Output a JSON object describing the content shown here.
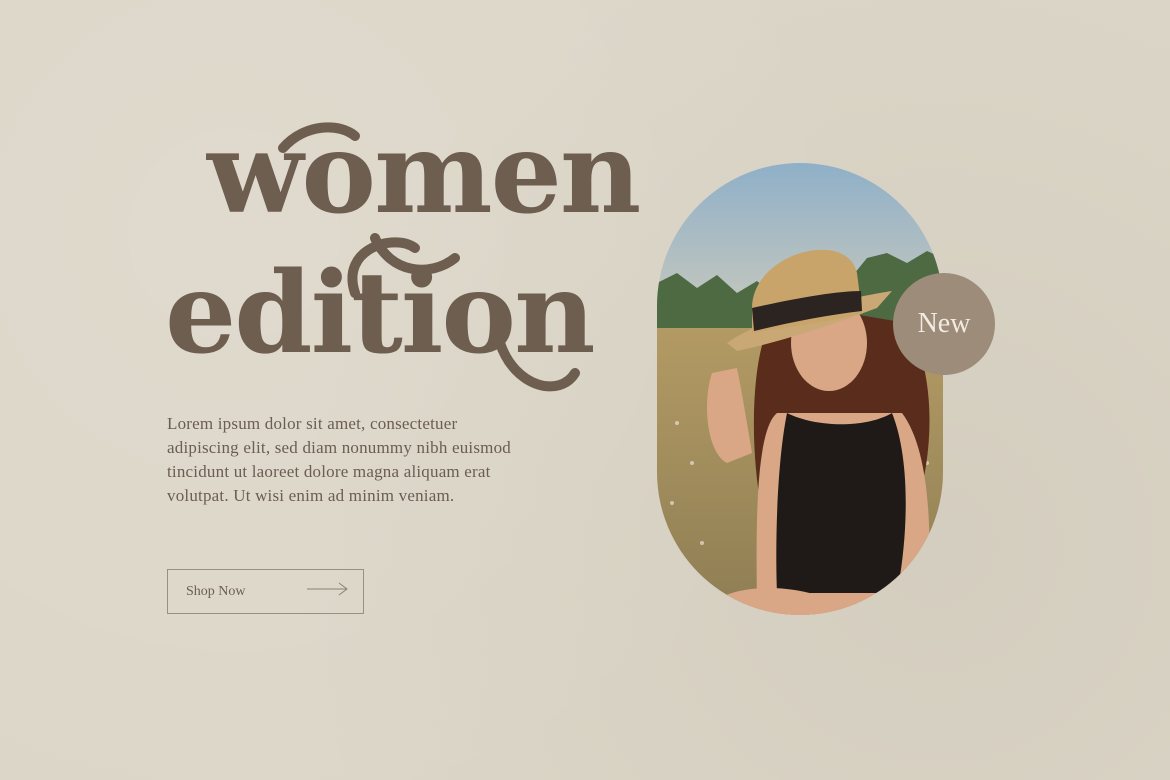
{
  "hero": {
    "title_line1": "women",
    "title_line2": "edition",
    "description": "Lorem ipsum dolor sit amet, consectetuer adipiscing elit, sed diam nonummy nibh euismod tincidunt ut laoreet dolore magna aliquam erat volutpat. Ut wisi enim ad minim veniam.",
    "cta_label": "Shop Now",
    "cta_icon": "arrow-right-icon",
    "badge_label": "New"
  },
  "colors": {
    "background": "#dcd6c8",
    "headline": "#6e5e50",
    "body_text": "#6b5d50",
    "badge": "#9d8c7a",
    "badge_text": "#f1ebe1"
  }
}
